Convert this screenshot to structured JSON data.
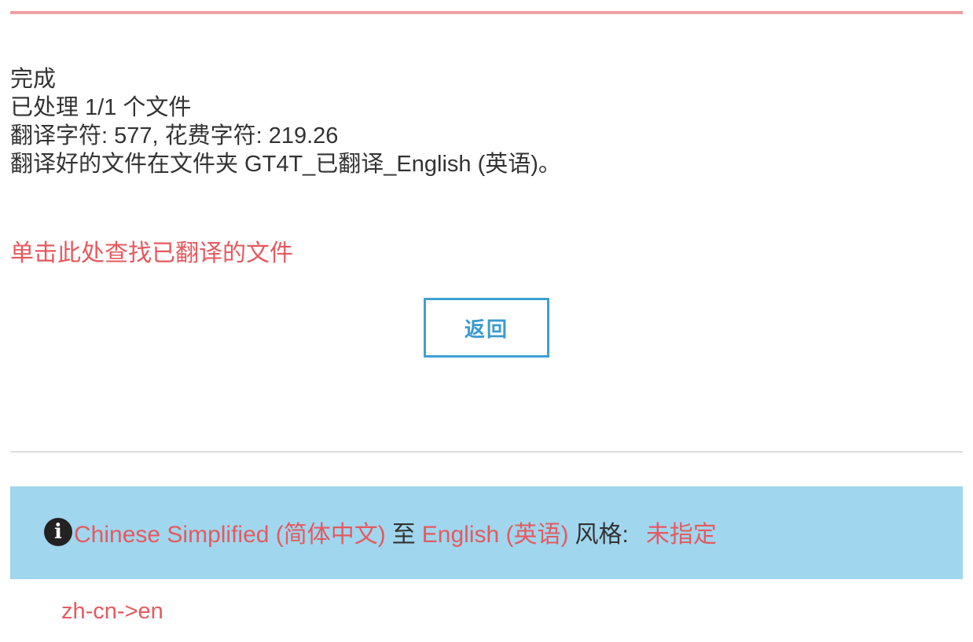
{
  "status": {
    "line1": "完成",
    "line2": "已处理 1/1 个文件",
    "line3": "翻译字符: 577, 花费字符: 219.26",
    "line4": "翻译好的文件在文件夹 GT4T_已翻译_English (英语)。"
  },
  "find_link": {
    "label": "单击此处查找已翻译的文件"
  },
  "back_button": {
    "label": "返回"
  },
  "info_bar": {
    "icon": "info-icon",
    "icon_glyph": "i",
    "source_language": "Chinese Simplified (简体中文)",
    "to_word": "至",
    "target_language": "English (英语)",
    "style_label": "风格:",
    "style_value": "未指定"
  },
  "language_code": "zh-cn->en",
  "colors": {
    "accent_red": "#e55a5f",
    "top_rule": "#f0a0a4",
    "button_blue": "#3ea0d4",
    "info_bar_bg": "#a0d6ee",
    "text_dark": "#333333"
  }
}
